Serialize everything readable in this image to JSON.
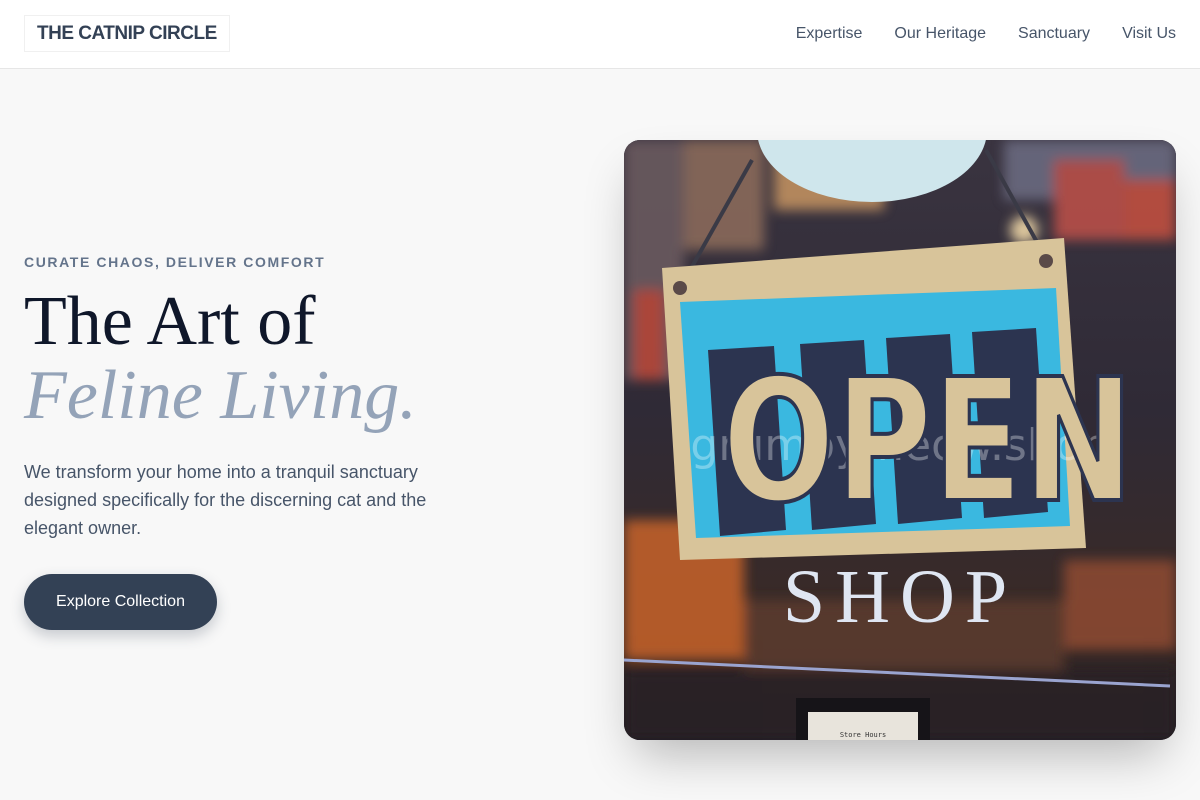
{
  "header": {
    "logo": "THE CATNIP CIRCLE",
    "nav": [
      {
        "label": "Expertise"
      },
      {
        "label": "Our Heritage"
      },
      {
        "label": "Sanctuary"
      },
      {
        "label": "Visit Us"
      }
    ]
  },
  "hero": {
    "kicker": "CURATE CHAOS, DELIVER COMFORT",
    "title_line1": "The Art of",
    "title_line2": "Feline Living.",
    "description": "We transform your home into a tranquil sanctuary designed specifically for the discerning cat and the elegant owner.",
    "cta_label": "Explore Collection"
  },
  "image": {
    "sign_text": "OPEN",
    "glass_text": "SHOP",
    "watermark": "grumpymeow.shop",
    "card_note": "Store Hours"
  },
  "colors": {
    "accent": "#334155",
    "muted_title": "#94a3b8",
    "sign_blue": "#3ab8e0",
    "sign_tan": "#d8c49a"
  }
}
